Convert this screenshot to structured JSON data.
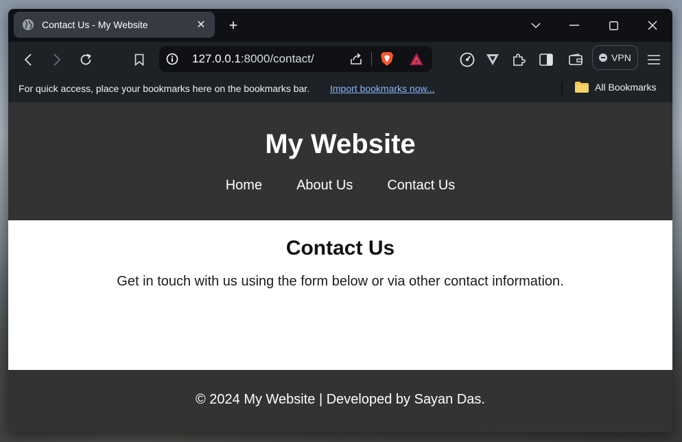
{
  "browser": {
    "tab_title": "Contact Us - My Website",
    "url_host": "127.0.0.1",
    "url_rest": ":8000/contact/",
    "vpn_label": "VPN",
    "bookmarks_hint": "For quick access, place your bookmarks here on the bookmarks bar.",
    "import_link": "Import bookmarks now...",
    "all_bookmarks": "All Bookmarks"
  },
  "site": {
    "title": "My Website",
    "nav": [
      "Home",
      "About Us",
      "Contact Us"
    ],
    "heading": "Contact Us",
    "intro": "Get in touch with us using the form below or via other contact information.",
    "footer": "© 2024 My Website | Developed by Sayan Das."
  },
  "colors": {
    "header_bg": "#333333",
    "link_blue": "#8ab4f8",
    "brave_orange": "#fb542b"
  }
}
